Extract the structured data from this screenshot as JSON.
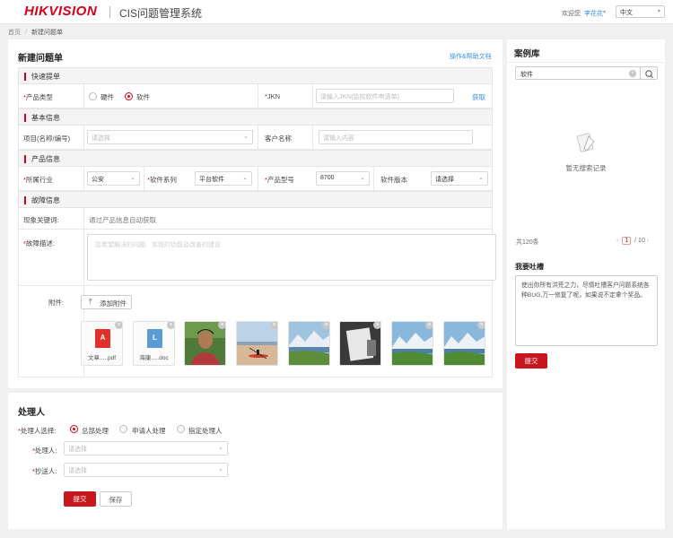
{
  "header": {
    "logo": "HIKVISION",
    "app_title": "CIS问题管理系统",
    "welcome": "欢迎您",
    "username": "李花花",
    "language": "中文"
  },
  "breadcrumb": {
    "home": "首页",
    "current": "新建问题单"
  },
  "form": {
    "title": "新建问题单",
    "help_link": "操作&帮助文档",
    "quick": {
      "section": "快速提单",
      "product_type_label": "产品类型",
      "option_hardware": "硬件",
      "option_software": "软件",
      "selected": "软件",
      "jkn_label": "JKN",
      "jkn_placeholder": "请输入JKN(监控软件申请单)",
      "fetch_link": "获取"
    },
    "basic": {
      "section": "基本信息",
      "project_label": "项目(名称/编号)",
      "project_placeholder": "请选择",
      "customer_label": "客户名称",
      "customer_placeholder": "请输入内容"
    },
    "product": {
      "section": "产品信息",
      "industry_label": "所属行业",
      "industry_value": "公安",
      "series_label": "软件系列",
      "series_value": "平台软件",
      "model_label": "产品型号",
      "model_value": "8700",
      "version_label": "软件版本",
      "version_value": "请选择"
    },
    "fault": {
      "section": "故障信息",
      "keyword_label": "现象关键词:",
      "keyword_value": "通过产品信息自动获取",
      "desc_label": "故障描述:",
      "desc_placeholder": "您希望解决的问题、实现的功能及改善的建议",
      "attach_label": "附件:",
      "upload_button": "添加附件",
      "files": [
        {
          "name": "文章.....pdf",
          "type": "pdf",
          "badge": "A"
        },
        {
          "name": "海康.....doc",
          "type": "doc",
          "badge": "L"
        }
      ],
      "images": [
        "portrait",
        "kayak",
        "lake",
        "paper",
        "mountains",
        "mountains"
      ]
    }
  },
  "handler": {
    "title": "处理人",
    "select_label": "处理人选择:",
    "options": [
      "总部处理",
      "申请人处理",
      "指定处理人"
    ],
    "selected": "总部处理",
    "handler_label": "处理人:",
    "handler_placeholder": "请选择",
    "cc_label": "抄送人:",
    "cc_placeholder": "请选择",
    "submit": "提交",
    "save": "保存"
  },
  "sidebar": {
    "title": "案例库",
    "search_value": "软件",
    "empty_text": "暂无搜索记录",
    "total": "共120条",
    "page_current": "1",
    "page_total": "/ 10",
    "feedback_title": "我要吐槽",
    "feedback_text": "使出你所有洪荒之力，尽情吐槽客户问题系统各种BUG,万一修复了呢，如果说不定拿个奖品。",
    "feedback_submit": "提交"
  }
}
